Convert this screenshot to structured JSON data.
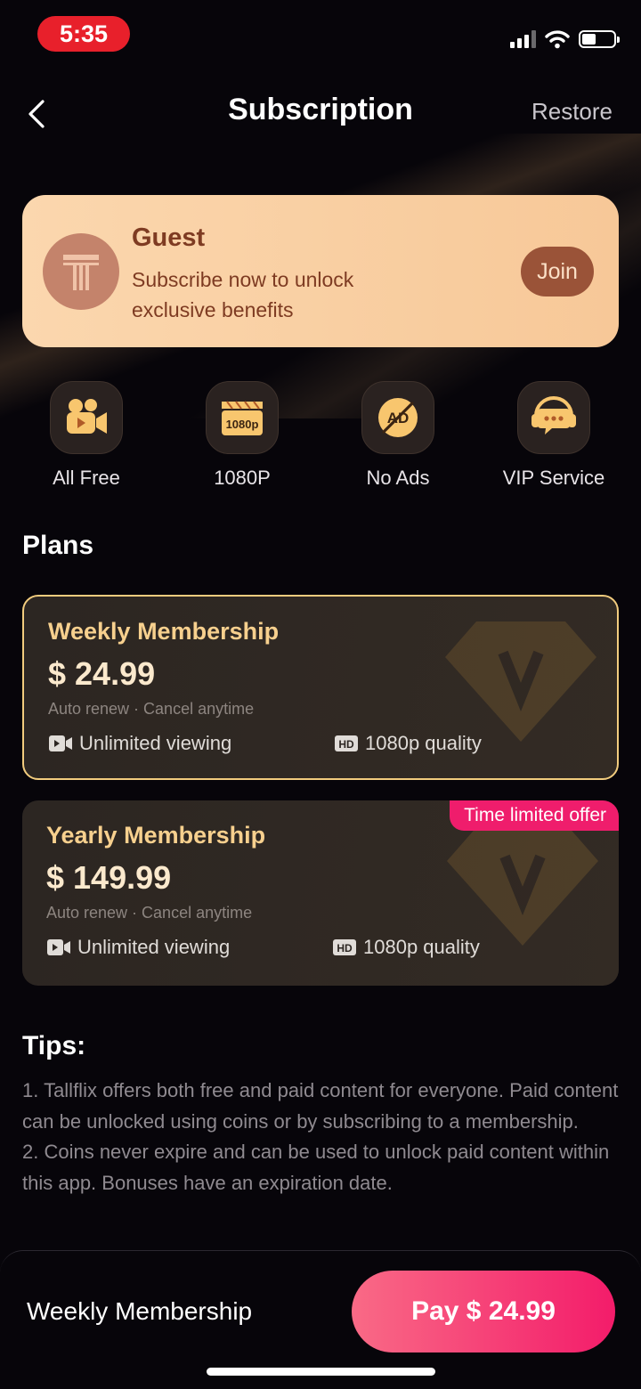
{
  "status_bar": {
    "time": "5:35"
  },
  "header": {
    "title": "Subscription",
    "restore_label": "Restore"
  },
  "guest": {
    "name": "Guest",
    "description": "Subscribe now to unlock exclusive benefits",
    "join_label": "Join"
  },
  "features": [
    {
      "label": "All Free",
      "icon": "video-camera-icon"
    },
    {
      "label": "1080P",
      "icon": "clapperboard-1080p-icon",
      "badge": "1080p"
    },
    {
      "label": "No Ads",
      "icon": "no-ads-icon",
      "badge": "AD"
    },
    {
      "label": "VIP Service",
      "icon": "headset-chat-icon"
    }
  ],
  "plans_title": "Plans",
  "plans": [
    {
      "name": "Weekly Membership",
      "price": "$ 24.99",
      "note": "Auto renew · Cancel anytime",
      "feature_1": "Unlimited viewing",
      "feature_2": "1080p quality",
      "selected": true
    },
    {
      "name": "Yearly Membership",
      "price": "$ 149.99",
      "note": "Auto renew · Cancel anytime",
      "feature_1": "Unlimited viewing",
      "feature_2": "1080p quality",
      "badge": "Time limited offer",
      "selected": false
    }
  ],
  "tips": {
    "title": "Tips:",
    "line_1": "1. Tallflix offers both free and paid content for everyone. Paid content can be unlocked using coins or by subscribing to a membership.",
    "line_2": "2. Coins never expire and can be used to unlock paid content within this app. Bonuses have an expiration date."
  },
  "bottom_bar": {
    "selected_plan": "Weekly Membership",
    "pay_label": "Pay $ 24.99"
  },
  "colors": {
    "accent_gold": "#f2cc7e",
    "pay_pink": "#f31c6a",
    "guest_card": "#fbd7ae",
    "offer_badge": "#ef1d6c"
  }
}
